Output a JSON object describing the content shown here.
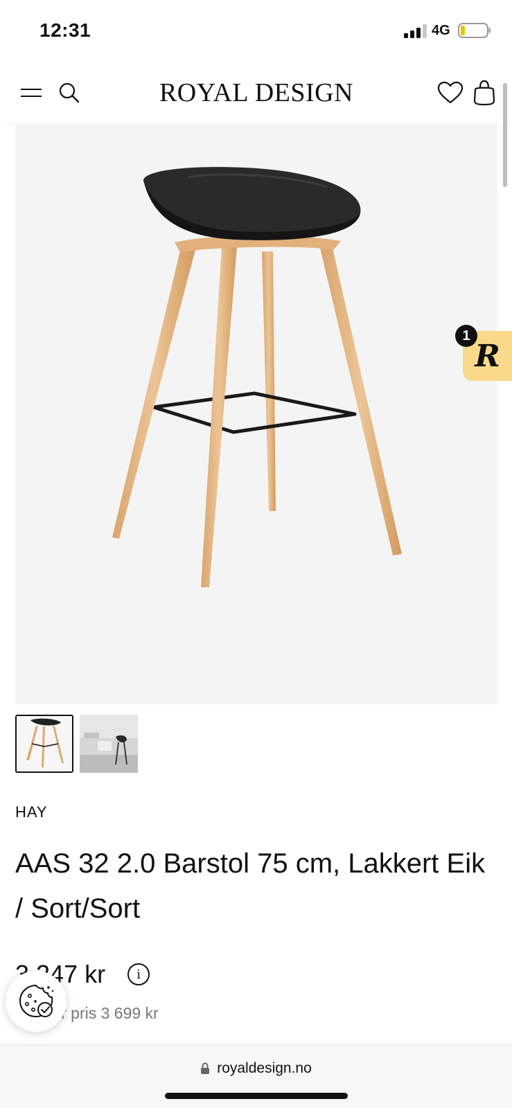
{
  "status_bar": {
    "time": "12:31",
    "network": "4G"
  },
  "header": {
    "logo": "ROYAL DESIGN",
    "icons": [
      "menu-icon",
      "search-icon",
      "heart-icon",
      "bag-icon"
    ]
  },
  "rating_badge": {
    "letter": "R",
    "count": "1",
    "color": "#fbd98a"
  },
  "product": {
    "brand": "HAY",
    "title": "AAS 32 2.0 Barstol 75 cm, Lakkert Eik / Sort/Sort",
    "price": "3 247 kr",
    "previous_price": "Før pris 3 699 kr",
    "thumbnails": [
      "Barstol produktbilde",
      "Barstol miljøbilde"
    ]
  },
  "browser": {
    "url": "royaldesign.no"
  }
}
